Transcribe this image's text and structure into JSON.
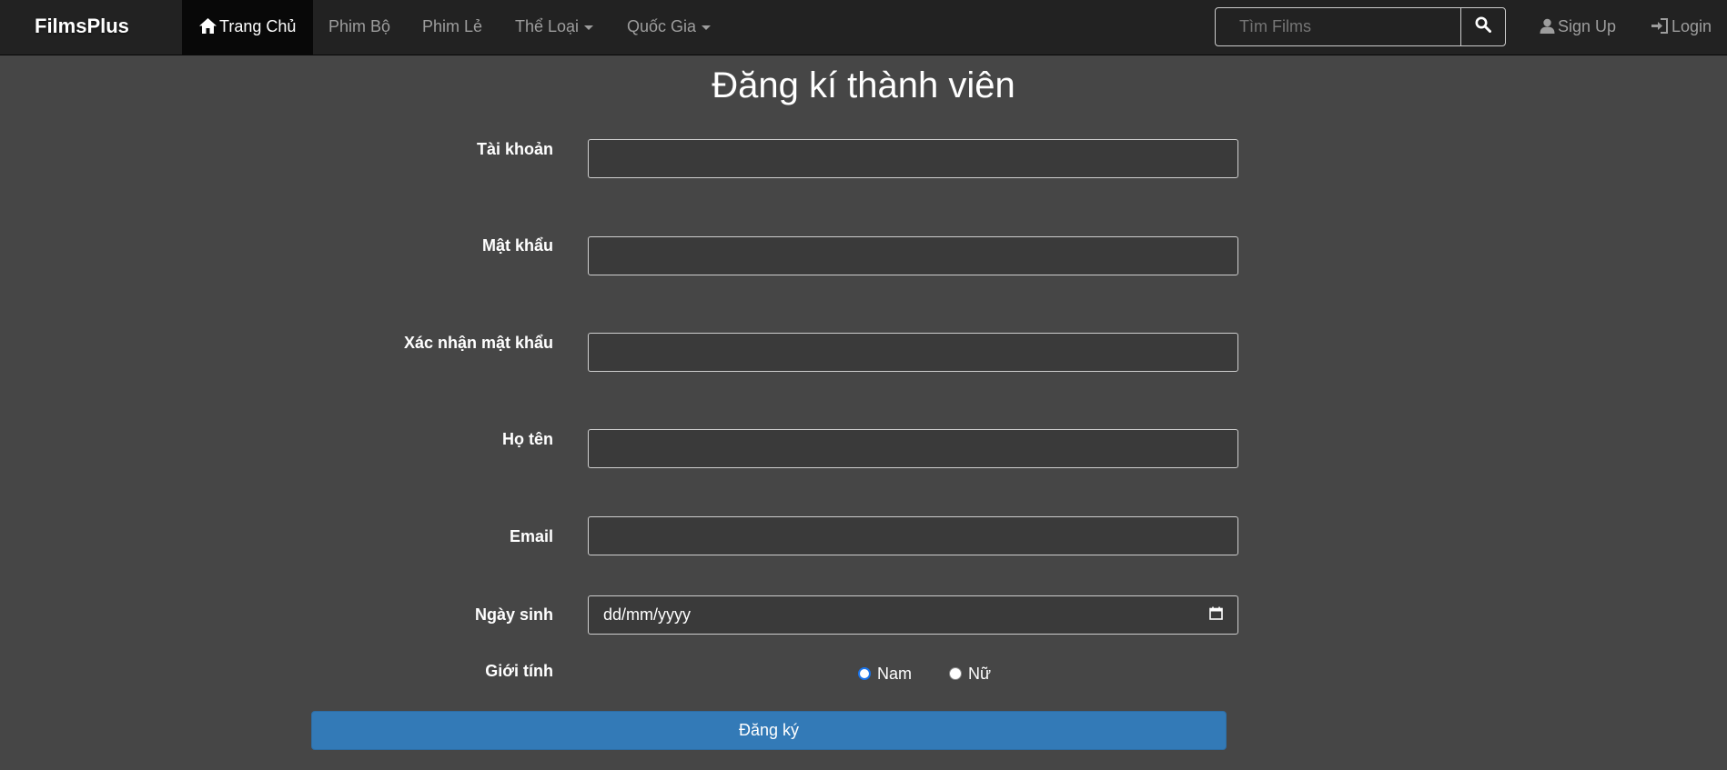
{
  "navbar": {
    "brand": "FilmsPlus",
    "home_label": "Trang Chủ",
    "series_label": "Phim Bộ",
    "movies_label": "Phim Lẻ",
    "genre_label": "Thể Loại",
    "country_label": "Quốc Gia",
    "search_placeholder": "Tìm Films",
    "signup_label": "Sign Up",
    "login_label": "Login"
  },
  "form": {
    "title": "Đăng kí thành viên",
    "username_label": "Tài khoản",
    "password_label": "Mật khẩu",
    "confirm_label": "Xác nhận mật khẩu",
    "fullname_label": "Họ tên",
    "email_label": "Email",
    "birthday_label": "Ngày sinh",
    "birthday_placeholder": "dd/mm/yyyy",
    "gender_label": "Giới tính",
    "gender_options": [
      "Nam",
      "Nữ"
    ],
    "gender_selected": "Nam",
    "submit_label": "Đăng ký"
  },
  "colors": {
    "page_bg": "#464646",
    "navbar_bg": "#222222",
    "primary": "#337ab7"
  }
}
